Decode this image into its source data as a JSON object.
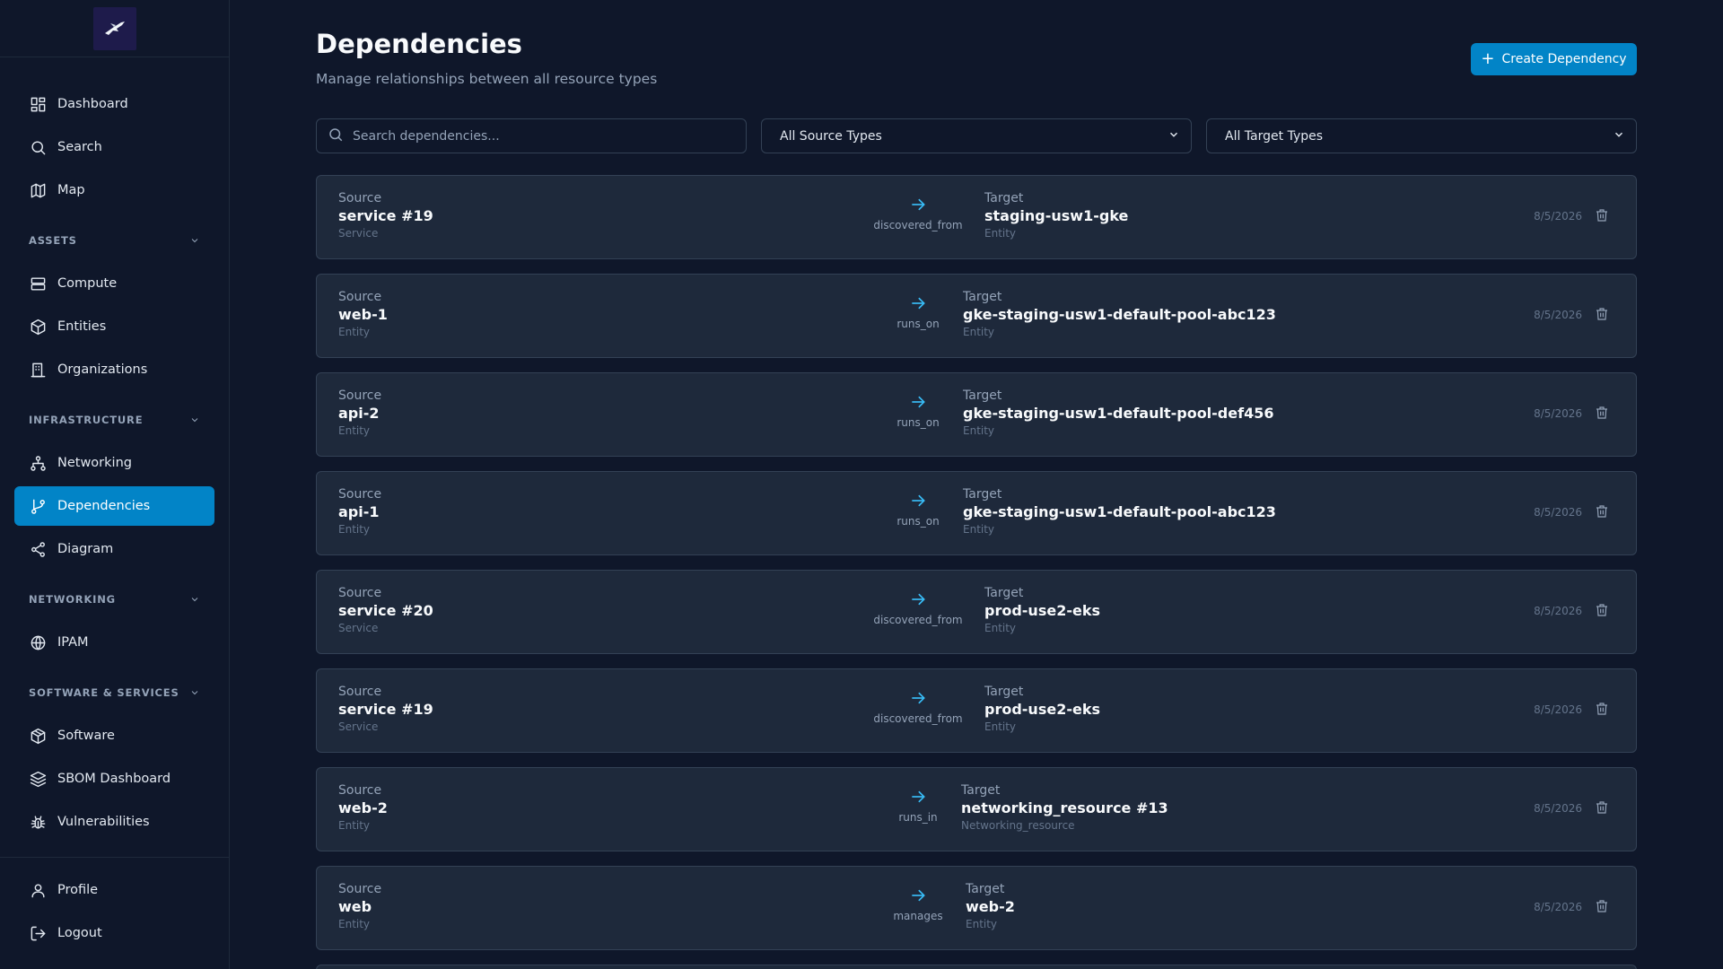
{
  "sidebar": {
    "nav_top": [
      {
        "label": "Dashboard",
        "icon": "dashboard-icon"
      },
      {
        "label": "Search",
        "icon": "search-icon"
      },
      {
        "label": "Map",
        "icon": "map-icon"
      }
    ],
    "sections": [
      {
        "title": "ASSETS",
        "items": [
          {
            "label": "Compute",
            "icon": "server-icon"
          },
          {
            "label": "Entities",
            "icon": "cube-icon"
          },
          {
            "label": "Organizations",
            "icon": "building-icon"
          }
        ]
      },
      {
        "title": "INFRASTRUCTURE",
        "items": [
          {
            "label": "Networking",
            "icon": "network-icon"
          },
          {
            "label": "Dependencies",
            "icon": "git-branch-icon",
            "active": true
          },
          {
            "label": "Diagram",
            "icon": "share-icon"
          }
        ]
      },
      {
        "title": "NETWORKING",
        "items": [
          {
            "label": "IPAM",
            "icon": "globe-icon"
          }
        ]
      },
      {
        "title": "SOFTWARE & SERVICES",
        "items": [
          {
            "label": "Software",
            "icon": "package-icon"
          },
          {
            "label": "SBOM Dashboard",
            "icon": "layers-icon"
          },
          {
            "label": "Vulnerabilities",
            "icon": "bug-icon"
          }
        ]
      }
    ],
    "bottom": [
      {
        "label": "Profile",
        "icon": "user-icon"
      },
      {
        "label": "Logout",
        "icon": "logout-icon"
      }
    ]
  },
  "header": {
    "title": "Dependencies",
    "subtitle": "Manage relationships between all resource types",
    "create_label": "Create Dependency"
  },
  "filters": {
    "search_placeholder": "Search dependencies...",
    "source_type": "All Source Types",
    "target_type": "All Target Types"
  },
  "dependencies": [
    {
      "source_label": "Source",
      "source": "service #19",
      "source_type": "Service",
      "relation": "discovered_from",
      "target_label": "Target",
      "target": "staging-usw1-gke",
      "target_type": "Entity",
      "date": "8/5/2026"
    },
    {
      "source_label": "Source",
      "source": "web-1",
      "source_type": "Entity",
      "relation": "runs_on",
      "target_label": "Target",
      "target": "gke-staging-usw1-default-pool-abc123",
      "target_type": "Entity",
      "date": "8/5/2026"
    },
    {
      "source_label": "Source",
      "source": "api-2",
      "source_type": "Entity",
      "relation": "runs_on",
      "target_label": "Target",
      "target": "gke-staging-usw1-default-pool-def456",
      "target_type": "Entity",
      "date": "8/5/2026"
    },
    {
      "source_label": "Source",
      "source": "api-1",
      "source_type": "Entity",
      "relation": "runs_on",
      "target_label": "Target",
      "target": "gke-staging-usw1-default-pool-abc123",
      "target_type": "Entity",
      "date": "8/5/2026"
    },
    {
      "source_label": "Source",
      "source": "service #20",
      "source_type": "Service",
      "relation": "discovered_from",
      "target_label": "Target",
      "target": "prod-use2-eks",
      "target_type": "Entity",
      "date": "8/5/2026"
    },
    {
      "source_label": "Source",
      "source": "service #19",
      "source_type": "Service",
      "relation": "discovered_from",
      "target_label": "Target",
      "target": "prod-use2-eks",
      "target_type": "Entity",
      "date": "8/5/2026"
    },
    {
      "source_label": "Source",
      "source": "web-2",
      "source_type": "Entity",
      "relation": "runs_in",
      "target_label": "Target",
      "target": "networking_resource #13",
      "target_type": "Networking_resource",
      "date": "8/5/2026"
    },
    {
      "source_label": "Source",
      "source": "web",
      "source_type": "Entity",
      "relation": "manages",
      "target_label": "Target",
      "target": "web-2",
      "target_type": "Entity",
      "date": "8/5/2026"
    }
  ],
  "colors": {
    "background": "#0f172a",
    "card": "#1e293b",
    "accent": "#0284c7",
    "arrow": "#38bdf8"
  }
}
